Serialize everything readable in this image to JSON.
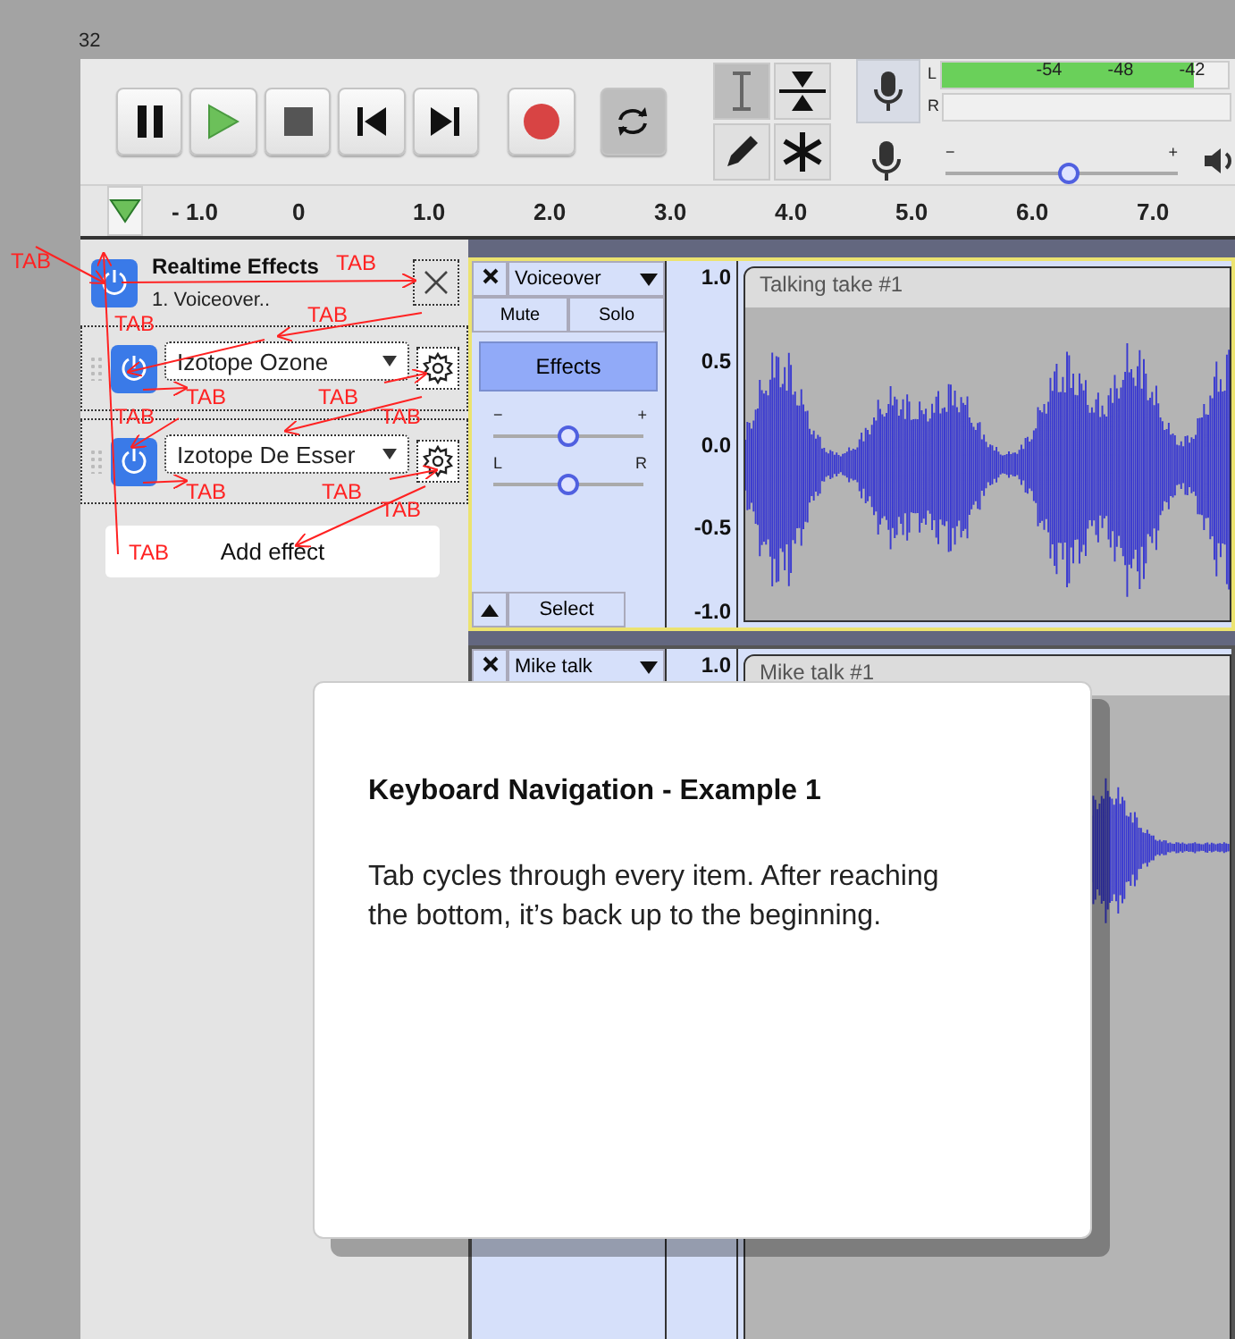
{
  "page_number": "32",
  "transport": [
    {
      "kind": "pause"
    },
    {
      "kind": "play"
    },
    {
      "kind": "stop"
    },
    {
      "kind": "skip-start"
    },
    {
      "kind": "skip-end"
    },
    {
      "kind": "record"
    },
    {
      "kind": "loop"
    }
  ],
  "tools": [
    {
      "kind": "select",
      "selected": true
    },
    {
      "kind": "envelope",
      "selected": false
    },
    {
      "kind": "draw",
      "selected": false
    },
    {
      "kind": "multi",
      "selected": false
    }
  ],
  "meter": {
    "channels": [
      {
        "label": "L",
        "level": 0.88
      },
      {
        "label": "R"
      }
    ],
    "ticks": [
      "-54",
      "-48",
      "-42"
    ]
  },
  "playback_volume": {
    "min_label": "−",
    "max_label": "+",
    "level": 0.53
  },
  "ruler": {
    "labels": [
      "- 1.0",
      "0",
      "1.0",
      "2.0",
      "3.0",
      "4.0",
      "5.0",
      "6.0",
      "7.0"
    ]
  },
  "effects_panel": {
    "title": "Realtime Effects",
    "track": "1. Voiceover..",
    "effects": [
      {
        "name": "Izotope Ozone"
      },
      {
        "name": "Izotope De Esser"
      }
    ],
    "add_button": "Add effect"
  },
  "tracks": [
    {
      "name": "Voiceover",
      "mute": "Mute",
      "solo": "Solo",
      "effects_button": {
        "label": "Effects",
        "selected": true
      },
      "gain": {
        "min_label": "−",
        "max_label": "+",
        "level": 0.5
      },
      "pan": {
        "min_label": "L",
        "max_label": "R",
        "level": 0.5
      },
      "select": "Select",
      "scale": [
        "1.0",
        "0.5",
        "0.0",
        "-0.5",
        "-1.0"
      ],
      "clip": "Talking take #1",
      "focused": true
    },
    {
      "name": "Mike talk",
      "scale": [
        "1.0"
      ],
      "clip": "Mike talk #1",
      "focused": false
    }
  ],
  "annotations": [
    {
      "label": "TAB"
    },
    {
      "label": "TAB"
    },
    {
      "label": "TAB"
    },
    {
      "label": "TAB"
    },
    {
      "label": "TAB"
    },
    {
      "label": "TAB"
    },
    {
      "label": "TAB"
    },
    {
      "label": "TAB"
    },
    {
      "label": "TAB"
    },
    {
      "label": "TAB"
    },
    {
      "label": "TAB"
    },
    {
      "label": "TAB"
    }
  ],
  "dialog": {
    "title": "Keyboard Navigation - Example 1",
    "body": "Tab cycles through every item. After reaching the bottom, it’s back up to the beginning."
  }
}
